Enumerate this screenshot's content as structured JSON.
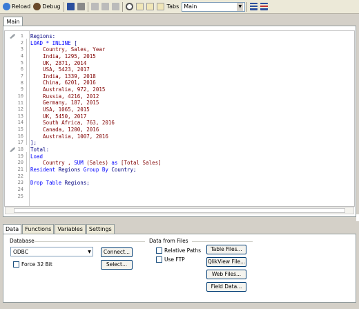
{
  "toolbar": {
    "reload_label": "Reload",
    "debug_label": "Debug",
    "tabs_label": "Tabs",
    "tabs_value": "Main"
  },
  "editor": {
    "main_tab_label": "Main",
    "lines": [
      [
        {
          "t": "Regions:",
          "c": "plain"
        }
      ],
      [
        {
          "t": "LOAD * ",
          "c": "kw"
        },
        {
          "t": "INLINE",
          "c": "kw"
        },
        {
          "t": " [",
          "c": "plain"
        }
      ],
      [
        {
          "t": "    Country, Sales, Year",
          "c": "field"
        }
      ],
      [
        {
          "t": "    India, 1295, 2015",
          "c": "field"
        }
      ],
      [
        {
          "t": "    UK, 2871, 2014",
          "c": "field"
        }
      ],
      [
        {
          "t": "    USA, 5423, 2017",
          "c": "field"
        }
      ],
      [
        {
          "t": "    India, 1339, 2018",
          "c": "field"
        }
      ],
      [
        {
          "t": "    China, 6201, 2016",
          "c": "field"
        }
      ],
      [
        {
          "t": "    Australia, 972, 2015",
          "c": "field"
        }
      ],
      [
        {
          "t": "    Russia, 4216, 2012",
          "c": "field"
        }
      ],
      [
        {
          "t": "    Germany, 187, 2015",
          "c": "field"
        }
      ],
      [
        {
          "t": "    USA, 1065, 2015",
          "c": "field"
        }
      ],
      [
        {
          "t": "    UK, 5450, 2017",
          "c": "field"
        }
      ],
      [
        {
          "t": "    South Africa, 763, 2016",
          "c": "field"
        }
      ],
      [
        {
          "t": "    Canada, 1200, 2016",
          "c": "field"
        }
      ],
      [
        {
          "t": "    Australia, 1007, 2016",
          "c": "field"
        }
      ],
      [
        {
          "t": "];",
          "c": "plain"
        }
      ],
      [
        {
          "t": "Total:",
          "c": "plain"
        }
      ],
      [
        {
          "t": "Load",
          "c": "kw"
        }
      ],
      [
        {
          "t": "    Country , ",
          "c": "field"
        },
        {
          "t": "SUM",
          "c": "func"
        },
        {
          "t": " (Sales) ",
          "c": "field"
        },
        {
          "t": "as",
          "c": "kw"
        },
        {
          "t": " [Total Sales]",
          "c": "field"
        }
      ],
      [
        {
          "t": "Resident",
          "c": "kw"
        },
        {
          "t": " Regions ",
          "c": "plain"
        },
        {
          "t": "Group By",
          "c": "kw"
        },
        {
          "t": " Country;",
          "c": "plain"
        }
      ],
      [
        {
          "t": "",
          "c": "plain"
        }
      ],
      [
        {
          "t": "Drop Table",
          "c": "kw"
        },
        {
          "t": " Regions;",
          "c": "plain"
        }
      ],
      [
        {
          "t": "",
          "c": "plain"
        }
      ],
      [
        {
          "t": "",
          "c": "plain"
        }
      ]
    ]
  },
  "bottom_tabs": [
    "Data",
    "Functions",
    "Variables",
    "Settings"
  ],
  "data_panel": {
    "database_label": "Database",
    "database_value": "ODBC",
    "connect_label": "Connect...",
    "select_label": "Select...",
    "force32_label": "Force 32 Bit",
    "data_from_files_label": "Data from Files",
    "relative_paths_label": "Relative Paths",
    "use_ftp_label": "Use FTP",
    "table_files_label": "Table Files...",
    "qlikview_file_label": "QlikView File...",
    "web_files_label": "Web Files...",
    "field_data_label": "Field Data..."
  }
}
